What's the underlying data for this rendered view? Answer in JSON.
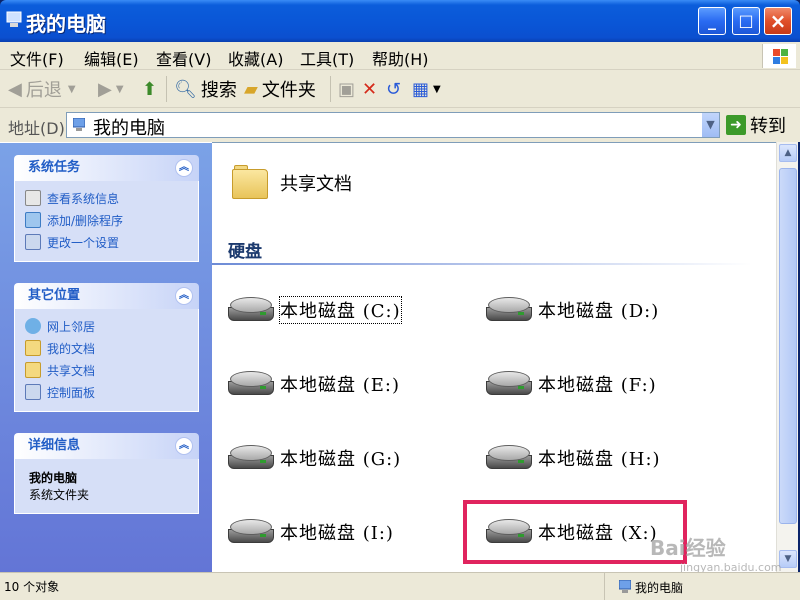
{
  "window": {
    "title": "我的电脑"
  },
  "menu": {
    "items": [
      "文件(F)",
      "编辑(E)",
      "查看(V)",
      "收藏(A)",
      "工具(T)",
      "帮助(H)"
    ]
  },
  "toolbar": {
    "back": "后退",
    "search": "搜索",
    "folders": "文件夹"
  },
  "address": {
    "label": "地址(D)",
    "value": "我的电脑",
    "go": "转到"
  },
  "tasks": {
    "system": {
      "title": "系统任务",
      "links": [
        "查看系统信息",
        "添加/删除程序",
        "更改一个设置"
      ]
    },
    "other": {
      "title": "其它位置",
      "links": [
        "网上邻居",
        "我的文档",
        "共享文档",
        "控制面板"
      ]
    },
    "details": {
      "title": "详细信息",
      "name": "我的电脑",
      "desc": "系统文件夹"
    }
  },
  "content": {
    "shared_folder": "共享文档",
    "group_title": "硬盘",
    "drives": [
      "本地磁盘 (C:)",
      "本地磁盘 (D:)",
      "本地磁盘 (E:)",
      "本地磁盘 (F:)",
      "本地磁盘 (G:)",
      "本地磁盘 (H:)",
      "本地磁盘 (I:)",
      "本地磁盘 (X:)"
    ]
  },
  "status": {
    "count": "10 个对象",
    "location": "我的电脑"
  },
  "watermark": {
    "text": "Bai经验",
    "url": "jingyan.baidu.com"
  },
  "colors": {
    "titlebar": "#0a55d6",
    "highlight": "#e0245e",
    "link": "#215dc6"
  }
}
